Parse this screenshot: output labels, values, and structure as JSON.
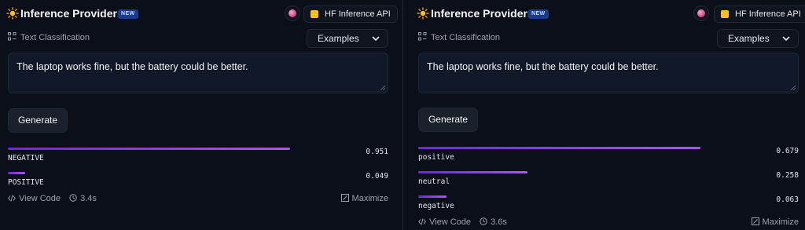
{
  "widgets": [
    {
      "header": {
        "title": "Inference Providers",
        "badge": "NEW",
        "provider_name": "HF Inference API"
      },
      "task": "Text Classification",
      "examples_label": "Examples",
      "input_text": "The laptop works fine, but the battery could be better.",
      "generate_label": "Generate",
      "results": [
        {
          "label": "NEGATIVE",
          "score": "0.951",
          "value": 0.951
        },
        {
          "label": "POSITIVE",
          "score": "0.049",
          "value": 0.049
        }
      ],
      "footer": {
        "view_code": "View Code",
        "time": "3.4s",
        "maximize": "Maximize"
      }
    },
    {
      "header": {
        "title": "Inference Providers",
        "badge": "NEW",
        "provider_name": "HF Inference API"
      },
      "task": "Text Classification",
      "examples_label": "Examples",
      "input_text": "The laptop works fine, but the battery could be better.",
      "generate_label": "Generate",
      "results": [
        {
          "label": "positive",
          "score": "0.679",
          "value": 0.679
        },
        {
          "label": "neutral",
          "score": "0.258",
          "value": 0.258
        },
        {
          "label": "negative",
          "score": "0.063",
          "value": 0.063
        }
      ],
      "footer": {
        "view_code": "View Code",
        "time": "3.6s",
        "maximize": "Maximize"
      }
    }
  ]
}
